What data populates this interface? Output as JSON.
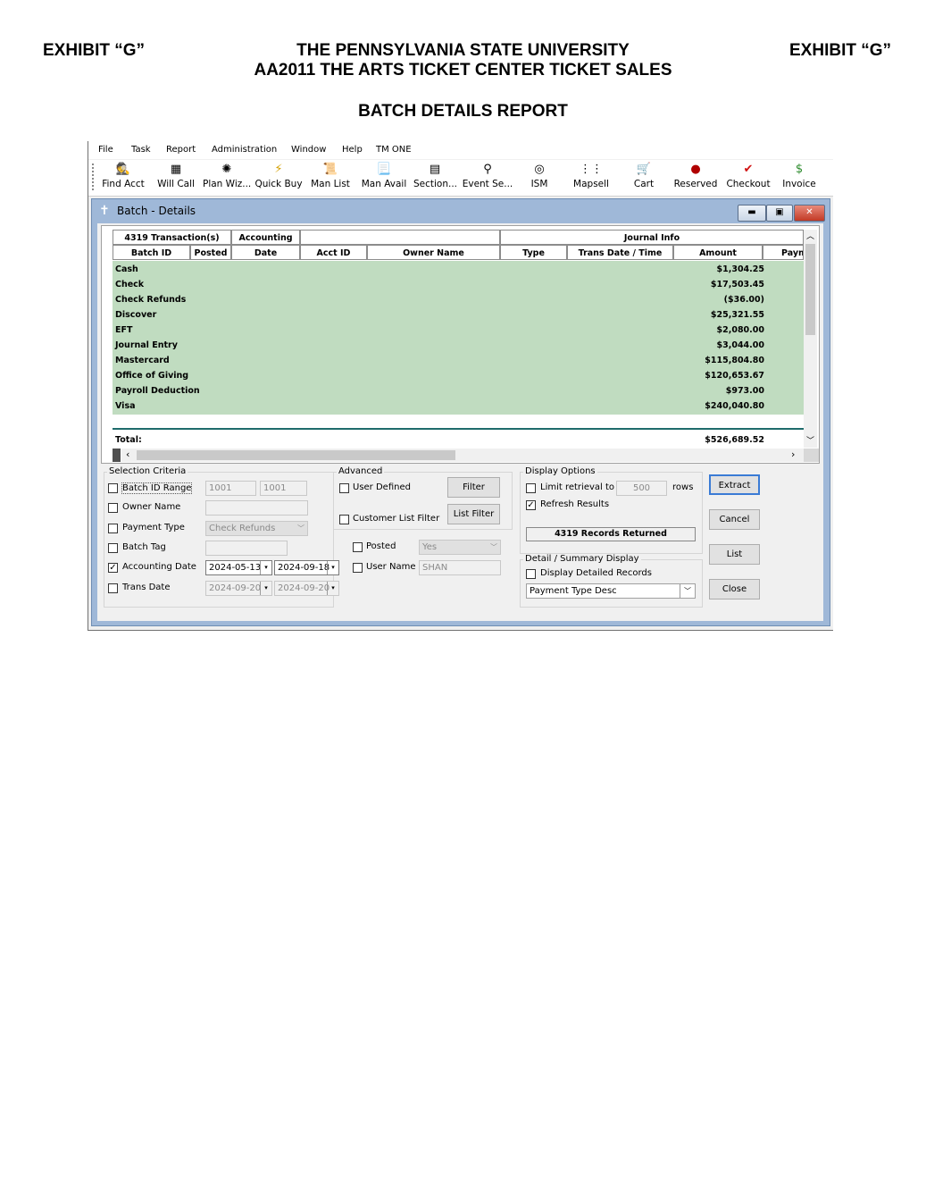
{
  "header": {
    "exhibit_left": "EXHIBIT “G”",
    "exhibit_right": "EXHIBIT “G”",
    "title_line1": "THE PENNSYLVANIA STATE UNIVERSITY",
    "title_line2": "AA2011 THE ARTS TICKET CENTER TICKET SALES",
    "report_title": "BATCH DETAILS REPORT"
  },
  "menu": [
    "File",
    "Task",
    "Report",
    "Administration",
    "Window",
    "Help",
    "TM ONE"
  ],
  "toolbar": [
    {
      "label": "Find Acct",
      "icon": "find-acct-icon"
    },
    {
      "label": "Will Call",
      "icon": "will-call-icon"
    },
    {
      "label": "Plan Wiz...",
      "icon": "plan-wizard-icon"
    },
    {
      "label": "Quick Buy",
      "icon": "quick-buy-icon"
    },
    {
      "label": "Man List",
      "icon": "man-list-icon"
    },
    {
      "label": "Man Avail",
      "icon": "man-avail-icon"
    },
    {
      "label": "Section...",
      "icon": "section-icon"
    },
    {
      "label": "Event Se...",
      "icon": "event-search-icon"
    },
    {
      "label": "ISM",
      "icon": "ism-icon"
    },
    {
      "label": "Mapsell",
      "icon": "mapsell-icon"
    },
    {
      "label": "Cart",
      "icon": "cart-icon"
    },
    {
      "label": "Reserved",
      "icon": "reserved-icon"
    },
    {
      "label": "Checkout",
      "icon": "checkout-icon"
    },
    {
      "label": "Invoice",
      "icon": "invoice-icon"
    }
  ],
  "window": {
    "title": "Batch - Details"
  },
  "grid": {
    "group_headers": {
      "transactions": "4319 Transaction(s)",
      "accounting": "Accounting",
      "journal_info": "Journal Info"
    },
    "columns": [
      "Batch ID",
      "Posted",
      "Date",
      "Acct ID",
      "Owner Name",
      "Type",
      "Trans Date / Time",
      "Amount",
      "Payme"
    ],
    "rows": [
      {
        "label": "Cash",
        "amount": "$1,304.25"
      },
      {
        "label": "Check",
        "amount": "$17,503.45"
      },
      {
        "label": "Check Refunds",
        "amount": "($36.00)"
      },
      {
        "label": "Discover",
        "amount": "$25,321.55"
      },
      {
        "label": "EFT",
        "amount": "$2,080.00"
      },
      {
        "label": "Journal Entry",
        "amount": "$3,044.00"
      },
      {
        "label": "Mastercard",
        "amount": "$115,804.80"
      },
      {
        "label": "Office of Giving",
        "amount": "$120,653.67"
      },
      {
        "label": "Payroll Deduction",
        "amount": "$973.00"
      },
      {
        "label": "Visa",
        "amount": "$240,040.80"
      }
    ],
    "total_label": "Total:",
    "total_amount": "$526,689.52"
  },
  "selection": {
    "title": "Selection Criteria",
    "batch_id_range": {
      "label": "Batch ID Range",
      "from": "1001",
      "to": "1001",
      "checked": false
    },
    "owner_name": {
      "label": "Owner Name",
      "value": "",
      "checked": false
    },
    "payment_type": {
      "label": "Payment Type",
      "value": "Check Refunds",
      "checked": false
    },
    "batch_tag": {
      "label": "Batch Tag",
      "value": "",
      "checked": false
    },
    "accounting_date": {
      "label": "Accounting Date",
      "from": "2024-05-13",
      "to": "2024-09-18",
      "checked": true
    },
    "trans_date": {
      "label": "Trans Date",
      "from": "2024-09-20",
      "to": "2024-09-20",
      "checked": false
    }
  },
  "advanced": {
    "title": "Advanced",
    "user_defined": "User Defined",
    "filter_button": "Filter",
    "customer_list_filter": "Customer List Filter",
    "list_filter_button": "List Filter",
    "posted": {
      "label": "Posted",
      "value": "Yes"
    },
    "user_name": {
      "label": "User Name",
      "value": "SHAN"
    }
  },
  "display": {
    "title": "Display Options",
    "limit_label": "Limit retrieval to",
    "limit_value": "500",
    "rows_label": "rows",
    "refresh_results": "Refresh Results",
    "records_returned": "4319 Records Returned",
    "detail_title": "Detail / Summary Display",
    "display_detailed": "Display Detailed Records",
    "sort_value": "Payment Type Desc"
  },
  "buttons": {
    "extract": "Extract",
    "cancel": "Cancel",
    "list": "List",
    "close": "Close"
  }
}
